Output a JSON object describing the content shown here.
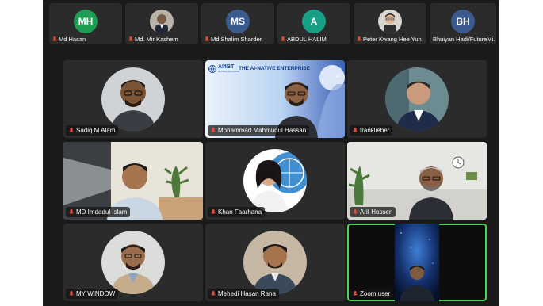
{
  "colors": {
    "active_speaker_border": "#4bd35a",
    "tile_bg": "#2b2b2b",
    "stage_bg": "#1a1a1a"
  },
  "strip": [
    {
      "name": "Md Hasan",
      "initials": "MH",
      "avatar_color": "#1f9d55",
      "photo": false
    },
    {
      "name": "Md. Mir Kashem",
      "initials": "",
      "avatar_color": "",
      "photo": true
    },
    {
      "name": "Md Shalim Sharder",
      "initials": "MS",
      "avatar_color": "#3b5b8f",
      "photo": false
    },
    {
      "name": "ABDUL HALIM",
      "initials": "A",
      "avatar_color": "#17a085",
      "photo": false
    },
    {
      "name": "Peter Kwang Hee Yun",
      "initials": "",
      "avatar_color": "",
      "photo": true
    },
    {
      "name": "Bhuiyan Hadi/FutureMi...",
      "initials": "BH",
      "avatar_color": "#3b5b8f",
      "photo": false
    }
  ],
  "banner": {
    "logo": "AI4BT",
    "logo_sub": "GLOBAL ALLIANCE",
    "headline": "THE AI-NATIVE ENTERPRISE",
    "badge": "AI"
  },
  "tiles": [
    {
      "name": "Sadiq M Alam",
      "type": "circle",
      "active": false
    },
    {
      "name": "Mohammad Mahmudul Hassan",
      "type": "banner",
      "active": false
    },
    {
      "name": "franklieber",
      "type": "circle",
      "active": false
    },
    {
      "name": "MD Imdadul Islam",
      "type": "office",
      "active": false
    },
    {
      "name": "Khan Faarhana",
      "type": "un",
      "active": false
    },
    {
      "name": "Arif Hossen",
      "type": "room",
      "active": false
    },
    {
      "name": "MY WINDOW",
      "type": "circle",
      "active": false
    },
    {
      "name": "Mehedi Hasan Rana",
      "type": "circle",
      "active": false
    },
    {
      "name": "Zoom user",
      "type": "space",
      "active": true
    }
  ]
}
